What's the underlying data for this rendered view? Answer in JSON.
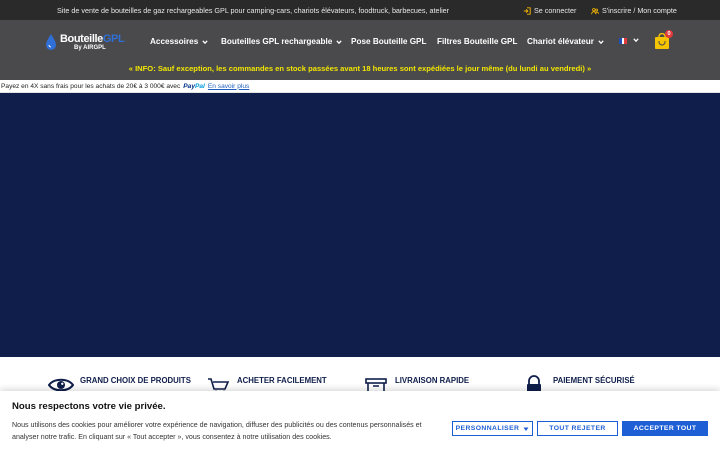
{
  "topbar": {
    "tagline": "Site de vente de bouteilles de gaz rechargeables GPL pour camping-cars, chariots élévateurs, foodtruck, barbecues, atelier",
    "login": "Se connecter",
    "signup": "S'inscrire / Mon compte",
    "login_icon": "login-arrow-icon",
    "signup_icon": "user-group-icon"
  },
  "logo": {
    "line1_a": "Bouteille",
    "line1_b": "GPL",
    "line2": "By AIRGPL",
    "icon": "gas-drop-icon"
  },
  "nav": {
    "items": [
      {
        "label": "Accessoires",
        "dropdown": true
      },
      {
        "label": "Bouteilles GPL rechargeable",
        "dropdown": true
      },
      {
        "label": "Pose Bouteille GPL",
        "dropdown": false
      },
      {
        "label": "Filtres Bouteille GPL",
        "dropdown": false
      },
      {
        "label": "Chariot élévateur",
        "dropdown": true
      }
    ],
    "language_icon": "french-flag-icon",
    "cart_icon": "shopping-bag-icon",
    "cart_count": "0"
  },
  "info_banner": "« INFO: Sauf exception, les commandes en stock passées avant 18 heures sont expédiées le jour même (du lundi au vendredi) »",
  "paypal": {
    "text": "Payez en 4X sans frais pour les achats de 20€ à 3 000€ avec",
    "brand_a": "Pay",
    "brand_b": "Pal",
    "link": "En savoir plus"
  },
  "features": [
    {
      "label": "GRAND CHOIX DE PRODUITS",
      "icon": "eye-icon"
    },
    {
      "label": "ACHETER FACILEMENT",
      "icon": "cart-icon"
    },
    {
      "label": "LIVRAISON RAPIDE",
      "icon": "delivery-box-icon"
    },
    {
      "label": "PAIEMENT SÉCURISÉ",
      "icon": "padlock-icon"
    }
  ],
  "cookie": {
    "title": "Nous respectons votre vie privée.",
    "text": "Nous utilisons des cookies pour améliorer votre expérience de navigation, diffuser des publicités ou des contenus personnalisés et analyser notre trafic. En cliquant sur « Tout accepter », vous consentez à notre utilisation des cookies.",
    "customize": "PERSONNALISER",
    "reject": "TOUT REJETER",
    "accept": "ACCEPTER TOUT"
  },
  "colors": {
    "topbar": "#2a2a2a",
    "header": "#4a4a4c",
    "info_text": "#f2e600",
    "hero": "#0f1e4b",
    "accent": "#1f5fd6",
    "cart": "#f5c400"
  }
}
